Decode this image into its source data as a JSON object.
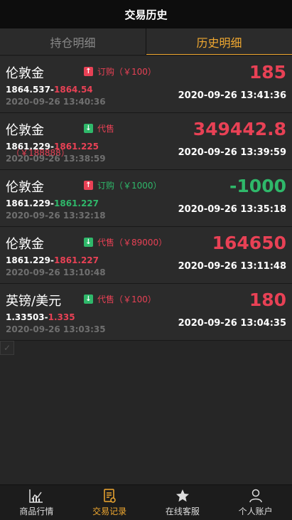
{
  "header": {
    "title": "交易历史"
  },
  "tabs": [
    {
      "label": "持仓明细",
      "active": false
    },
    {
      "label": "历史明细",
      "active": true
    }
  ],
  "records": [
    {
      "name": "伦敦金",
      "direction": "up",
      "direction_label": "订购（￥100）",
      "open_price": "1864.537-",
      "close_price": "1864.54",
      "open_time": "2020-09-26 13:40:36",
      "amount": "185",
      "close_time": "2020-09-26 13:41:36",
      "extra": ""
    },
    {
      "name": "伦敦金",
      "direction": "down",
      "direction_label": "代售",
      "open_price": "1861.229-",
      "close_price": "1861.225",
      "open_time": "2020-09-26 13:38:59",
      "amount": "349442.8",
      "close_time": "2020-09-26 13:39:59",
      "extra": "（￥188888）"
    },
    {
      "name": "伦敦金",
      "direction": "up",
      "direction_label": "订购（￥1000）",
      "open_price": "1861.229-",
      "close_price": "1861.227",
      "open_time": "2020-09-26 13:32:18",
      "amount": "-1000",
      "close_time": "2020-09-26 13:35:18",
      "extra": ""
    },
    {
      "name": "伦敦金",
      "direction": "down",
      "direction_label": "代售（￥89000）",
      "open_price": "1861.229-",
      "close_price": "1861.227",
      "open_time": "2020-09-26 13:10:48",
      "amount": "164650",
      "close_time": "2020-09-26 13:11:48",
      "extra": ""
    },
    {
      "name": "英镑/美元",
      "direction": "down",
      "direction_label": "代售（￥100）",
      "open_price": "1.33503-",
      "close_price": "1.335",
      "open_time": "2020-09-26 13:03:35",
      "amount": "180",
      "close_time": "2020-09-26 13:04:35",
      "extra": ""
    }
  ],
  "nav": [
    {
      "label": "商品行情",
      "icon": "chart-icon",
      "active": false
    },
    {
      "label": "交易记录",
      "icon": "document-icon",
      "active": true
    },
    {
      "label": "在线客服",
      "icon": "star-icon",
      "active": false
    },
    {
      "label": "个人账户",
      "icon": "user-icon",
      "active": false
    }
  ],
  "colors": {
    "accent": "#f0a830",
    "red": "#e84155",
    "green": "#2fb86a"
  }
}
